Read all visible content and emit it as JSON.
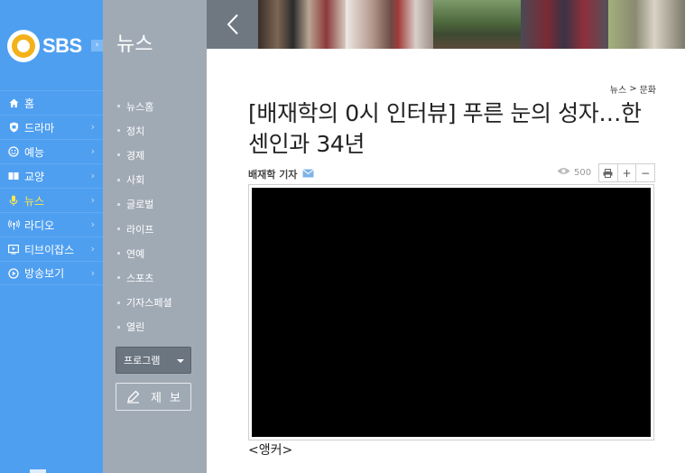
{
  "brand": {
    "logo_text": "SBS",
    "logo_arrow": "›"
  },
  "colors": {
    "sidebar_blue": "#4f9ff0",
    "subbar_gray": "#a0aab5",
    "active_yellow": "#ffe84a",
    "logo_orange": "#f3b21a"
  },
  "nav": {
    "items": [
      {
        "label": "홈",
        "icon": "home-icon"
      },
      {
        "label": "드라마",
        "icon": "shield-icon",
        "chevron": "›"
      },
      {
        "label": "예능",
        "icon": "smile-icon",
        "chevron": "›"
      },
      {
        "label": "교양",
        "icon": "book-icon",
        "chevron": "›"
      },
      {
        "label": "뉴스",
        "icon": "microphone-icon",
        "chevron": "›",
        "active": true
      },
      {
        "label": "라디오",
        "icon": "radio-icon",
        "chevron": "›"
      },
      {
        "label": "티브이잡스",
        "icon": "tv-icon",
        "chevron": "›"
      },
      {
        "label": "방송보기",
        "icon": "play-circle-icon",
        "chevron": "›"
      }
    ]
  },
  "subnav": {
    "title": "뉴스",
    "items": [
      "뉴스홈",
      "정치",
      "경제",
      "사회",
      "글로벌",
      "라이프",
      "연예",
      "스포츠",
      "기자스페셜",
      "열린"
    ],
    "program_select": "프로그램",
    "report_button": "제보"
  },
  "article": {
    "breadcrumb": {
      "parent": "뉴스",
      "separator": ">",
      "current": "문화"
    },
    "headline": "[배재학의 0시 인터뷰] 푸른 눈의 성자…한센인과 34년",
    "reporter": "배재학 기자",
    "views": "500",
    "tools": {
      "zoom_in": "+",
      "zoom_out": "−"
    },
    "anchor_label": "<앵커>"
  }
}
